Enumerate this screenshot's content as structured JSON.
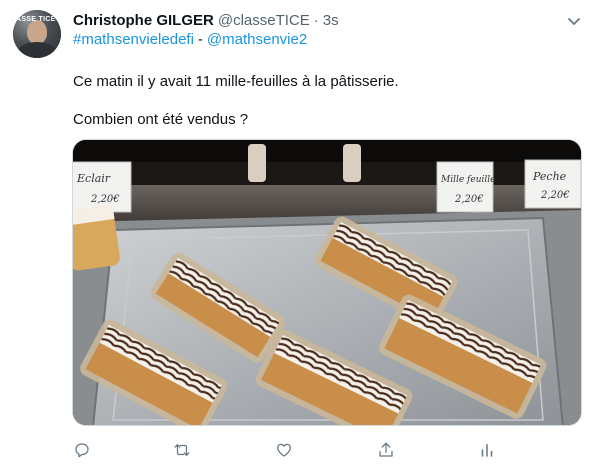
{
  "tweet": {
    "author_name": "Christophe GILGER",
    "author_handle": "@classeTICE",
    "separator": "·",
    "timestamp": "3s",
    "hashtag": "#mathsenvieledefi",
    "tag_separator": "-",
    "mention": "@mathsenvie2",
    "line1": "Ce matin il y avait 11 mille-feuilles à la pâtisserie.",
    "line2": "Combien ont été vendus ?"
  },
  "media": {
    "description_labels": {
      "sign_left": "Eclair 2,20€",
      "sign_middle": "Mille feuille 2,20€",
      "sign_right": "Peche 2,20€"
    }
  },
  "actions": {
    "reply_icon": "reply-icon",
    "retweet_icon": "retweet-icon",
    "like_icon": "like-icon",
    "share_icon": "share-icon",
    "analytics_icon": "analytics-icon"
  },
  "colors": {
    "link": "#1b95e0",
    "secondary_text": "#536471",
    "icon": "#657786"
  },
  "avatar_badge": "ASSE TICE"
}
